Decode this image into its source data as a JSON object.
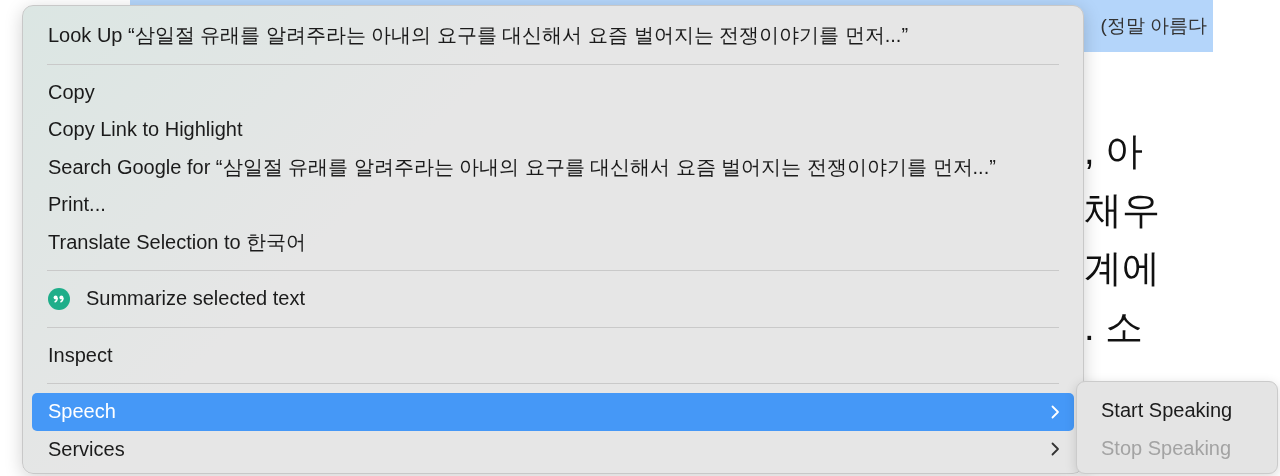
{
  "page": {
    "selected_text": "(정말 아름다",
    "text_lines": [
      ", 아",
      "채우",
      "계에",
      ". 소"
    ]
  },
  "context_menu": {
    "items": [
      {
        "kind": "item",
        "label": "Look Up “삼일절 유래를 알려주라는 아내의 요구를 대신해서 요즘 벌어지는 전쟁이야기를 먼저...”",
        "selected": false,
        "has_submenu": false
      },
      {
        "kind": "separator"
      },
      {
        "kind": "item",
        "label": "Copy",
        "selected": false,
        "has_submenu": false
      },
      {
        "kind": "item",
        "label": "Copy Link to Highlight",
        "selected": false,
        "has_submenu": false
      },
      {
        "kind": "item",
        "label": "Search Google for “삼일절 유래를 알려주라는 아내의 요구를 대신해서 요즘 벌어지는 전쟁이야기를 먼저...”",
        "selected": false,
        "has_submenu": false
      },
      {
        "kind": "item",
        "label": "Print...",
        "selected": false,
        "has_submenu": false
      },
      {
        "kind": "item",
        "label": "Translate Selection to 한국어",
        "selected": false,
        "has_submenu": false
      },
      {
        "kind": "separator"
      },
      {
        "kind": "icon_item",
        "label": "Summarize selected text",
        "selected": false,
        "has_submenu": false
      },
      {
        "kind": "separator"
      },
      {
        "kind": "item",
        "label": "Inspect",
        "selected": false,
        "has_submenu": false
      },
      {
        "kind": "separator"
      },
      {
        "kind": "item",
        "label": "Speech",
        "selected": true,
        "has_submenu": true
      },
      {
        "kind": "item",
        "label": "Services",
        "selected": false,
        "has_submenu": true
      }
    ]
  },
  "submenu": {
    "items": [
      {
        "label": "Start Speaking",
        "disabled": false
      },
      {
        "label": "Stop Speaking",
        "disabled": true
      }
    ]
  }
}
